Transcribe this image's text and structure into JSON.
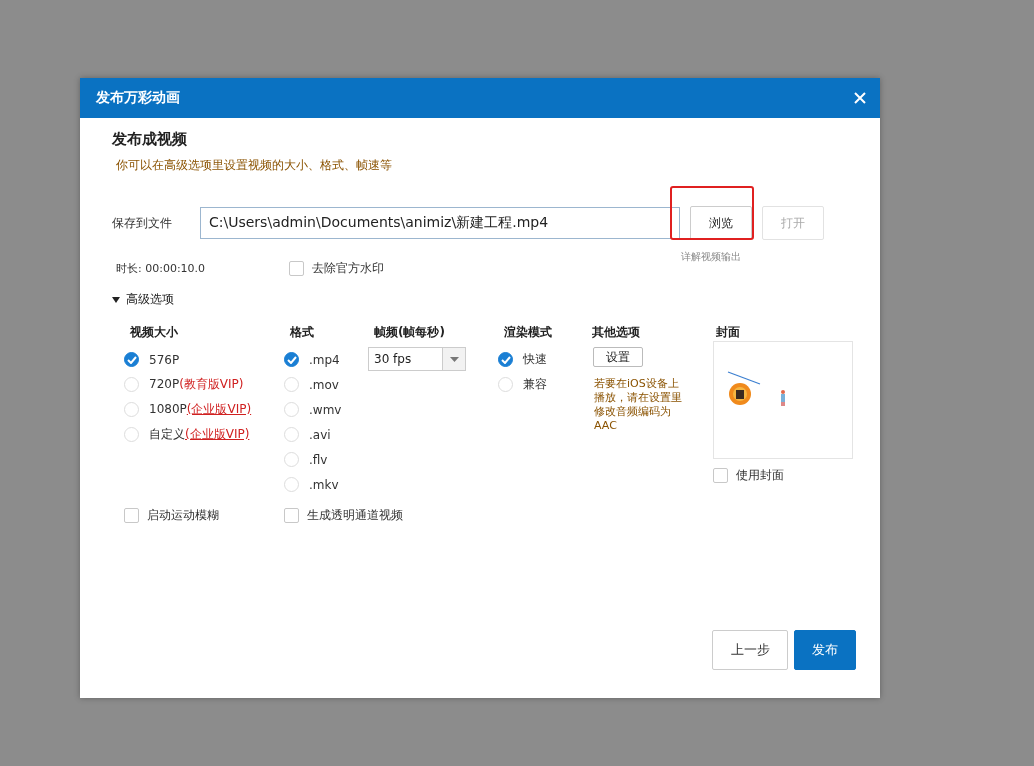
{
  "window": {
    "title": "发布万彩动画"
  },
  "heading": "发布成视频",
  "subtitle": "你可以在高级选项里设置视频的大小、格式、帧速等",
  "save": {
    "label": "保存到文件",
    "value": "C:\\Users\\admin\\Documents\\animiz\\新建工程.mp4"
  },
  "file_buttons": [
    {
      "label": "浏览",
      "disabled": false,
      "highlighted": true
    },
    {
      "label": "打开",
      "disabled": true,
      "highlighted": false
    }
  ],
  "help_link": "详解视频输出",
  "duration": "时长: 00:00:10.0",
  "remove_watermark": {
    "label": "去除官方水印",
    "checked": false
  },
  "advanced": {
    "label": "高级选项",
    "expanded": true
  },
  "size": {
    "title": "视频大小",
    "options": [
      {
        "label": "576P",
        "selected": true
      },
      {
        "label": "720P",
        "tag": "(教育版VIP)",
        "tag_underline": false,
        "selected": false
      },
      {
        "label": "1080P",
        "tag": "(企业版VIP)",
        "tag_underline": true,
        "selected": false
      },
      {
        "label": "自定义",
        "tag": "(企业版VIP)",
        "tag_underline": true,
        "selected": false
      }
    ]
  },
  "format": {
    "title": "格式",
    "options": [
      {
        "label": ".mp4",
        "selected": true
      },
      {
        "label": ".mov",
        "selected": false
      },
      {
        "label": ".wmv",
        "selected": false
      },
      {
        "label": ".avi",
        "selected": false
      },
      {
        "label": ".flv",
        "selected": false
      },
      {
        "label": ".mkv",
        "selected": false
      }
    ]
  },
  "fps": {
    "title": "帧频(帧每秒)",
    "value": "30 fps"
  },
  "render": {
    "title": "渲染模式",
    "options": [
      {
        "label": "快速",
        "selected": true
      },
      {
        "label": "兼容",
        "selected": false
      }
    ]
  },
  "other": {
    "title": "其他选项",
    "button": "设置",
    "note": "若要在iOS设备上播放，请在设置里修改音频编码为AAC"
  },
  "cover": {
    "title": "封面",
    "use": {
      "label": "使用封面",
      "checked": false
    }
  },
  "motion_blur": {
    "label": "启动运动模糊",
    "checked": false
  },
  "alpha_video": {
    "label": "生成透明通道视频",
    "checked": false
  },
  "footer": [
    {
      "label": "上一步",
      "kind": "secondary"
    },
    {
      "label": "发布",
      "kind": "primary"
    }
  ]
}
